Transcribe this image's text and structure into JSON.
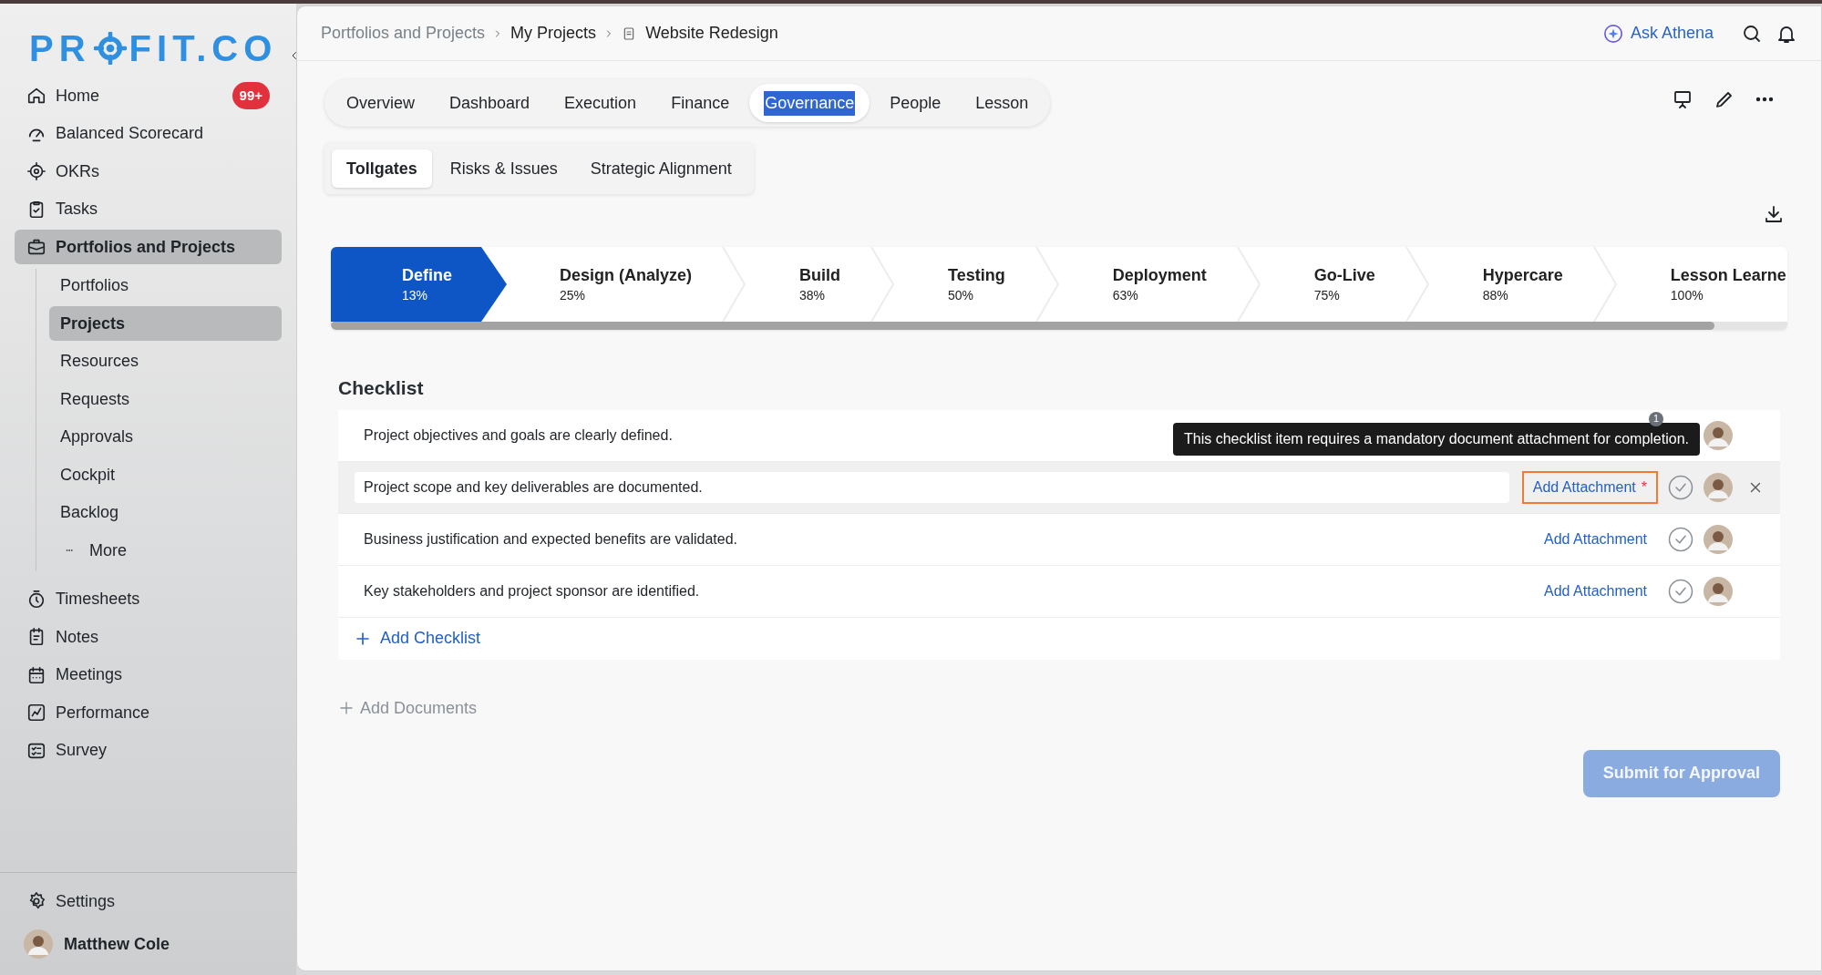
{
  "sidebar": {
    "logo": {
      "left": "PR",
      "right": "FIT.CO"
    },
    "items": [
      {
        "label": "Home",
        "badge": "99+",
        "selected": false
      },
      {
        "label": "Balanced Scorecard",
        "selected": false
      },
      {
        "label": "OKRs",
        "selected": false
      },
      {
        "label": "Tasks",
        "selected": false
      },
      {
        "label": "Portfolios and Projects",
        "selected": true,
        "children": [
          {
            "label": "Portfolios",
            "selected": false
          },
          {
            "label": "Projects",
            "selected": true
          },
          {
            "label": "Resources",
            "selected": false
          },
          {
            "label": "Requests",
            "selected": false
          },
          {
            "label": "Approvals",
            "selected": false
          },
          {
            "label": "Cockpit",
            "selected": false
          },
          {
            "label": "Backlog",
            "selected": false
          },
          {
            "label": "More",
            "kind": "more",
            "selected": false
          }
        ]
      },
      {
        "label": "Timesheets",
        "selected": false
      },
      {
        "label": "Notes",
        "selected": false
      },
      {
        "label": "Meetings",
        "selected": false
      },
      {
        "label": "Performance",
        "selected": false
      },
      {
        "label": "Survey",
        "selected": false
      }
    ],
    "settings": "Settings",
    "user": "Matthew Cole"
  },
  "breadcrumb": [
    "Portfolios and Projects",
    "My Projects",
    "Website Redesign"
  ],
  "ask": "Ask Athena",
  "tabs": [
    {
      "label": "Overview",
      "selected": false
    },
    {
      "label": "Dashboard",
      "selected": false
    },
    {
      "label": "Execution",
      "selected": false
    },
    {
      "label": "Finance",
      "selected": false
    },
    {
      "label": "Governance",
      "selected": true
    },
    {
      "label": "People",
      "selected": false
    },
    {
      "label": "Lesson",
      "selected": false
    }
  ],
  "subtabs": [
    {
      "label": "Tollgates",
      "selected": true
    },
    {
      "label": "Risks & Issues",
      "selected": false
    },
    {
      "label": "Strategic Alignment",
      "selected": false
    }
  ],
  "stages": [
    {
      "name": "Define",
      "percent": "13%",
      "selected": true
    },
    {
      "name": "Design (Analyze)",
      "percent": "25%",
      "selected": false
    },
    {
      "name": "Build",
      "percent": "38%",
      "selected": false
    },
    {
      "name": "Testing",
      "percent": "50%",
      "selected": false
    },
    {
      "name": "Deployment",
      "percent": "63%",
      "selected": false
    },
    {
      "name": "Go-Live",
      "percent": "75%",
      "selected": false
    },
    {
      "name": "Hypercare",
      "percent": "88%",
      "selected": false
    },
    {
      "name": "Lesson Learne",
      "percent": "100%",
      "selected": false
    }
  ],
  "checklist": {
    "title": "Checklist",
    "items": [
      {
        "text": "Project objectives and goals are clearly defined.",
        "editing": false,
        "tooltip": "This checklist item requires a mandatory document attachment for completion.",
        "count": "1"
      },
      {
        "text": "Project scope and key deliverables are documented.",
        "editing": true,
        "attachment": "Add Attachment",
        "required": true,
        "required_mark": "*"
      },
      {
        "text": "Business justification and expected benefits are validated.",
        "editing": false,
        "attachment": "Add Attachment",
        "required": false
      },
      {
        "text": "Key stakeholders and project sponsor are identified.",
        "editing": false,
        "attachment": "Add Attachment",
        "required": false
      }
    ],
    "add": "Add Checklist"
  },
  "add_documents": "Add Documents",
  "submit": {
    "label": "Submit for Approval",
    "disabled": true
  }
}
